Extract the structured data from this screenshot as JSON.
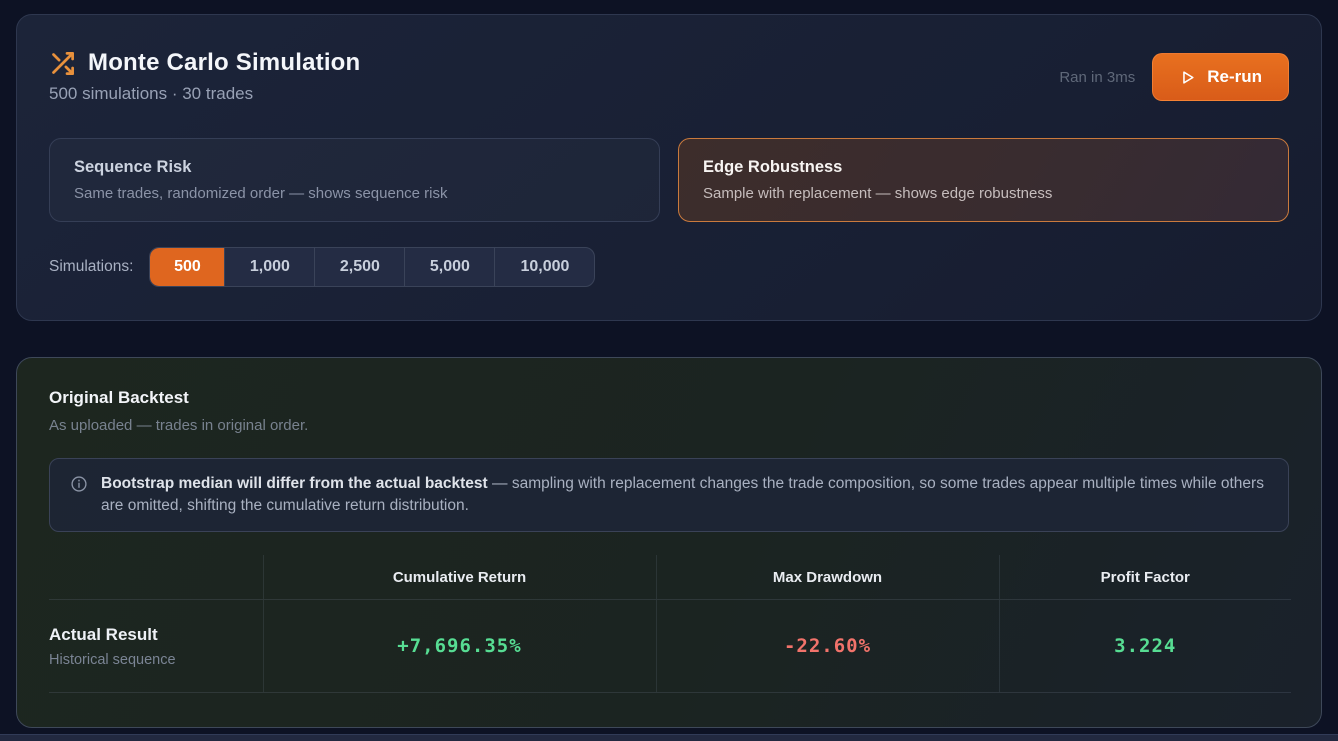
{
  "simulation_panel": {
    "title": "Monte Carlo Simulation",
    "subtitle": "500 simulations · 30 trades",
    "ran_in": "Ran in 3ms",
    "rerun_label": "Re-run",
    "modes": [
      {
        "title": "Sequence Risk",
        "description": "Same trades, randomized order — shows sequence risk",
        "selected": false
      },
      {
        "title": "Edge Robustness",
        "description": "Sample with replacement — shows edge robustness",
        "selected": true
      }
    ],
    "simulations_label": "Simulations:",
    "simulation_counts": [
      "500",
      "1,000",
      "2,500",
      "5,000",
      "10,000"
    ],
    "selected_count": "500"
  },
  "backtest_panel": {
    "title": "Original Backtest",
    "subtitle": "As uploaded — trades in original order.",
    "note": {
      "bold": "Bootstrap median will differ from the actual backtest",
      "rest": " — sampling with replacement changes the trade composition, so some trades appear multiple times while others are omitted, shifting the cumulative return distribution."
    },
    "table": {
      "columns": [
        "Cumulative Return",
        "Max Drawdown",
        "Profit Factor"
      ],
      "rows": [
        {
          "label": "Actual Result",
          "sublabel": "Historical sequence",
          "values": [
            "+7,696.35%",
            "-22.60%",
            "3.224"
          ],
          "value_colors": [
            "green",
            "red",
            "green"
          ]
        }
      ]
    }
  },
  "colors": {
    "accent_orange": "#df661f",
    "positive_green": "#57dd93",
    "negative_red": "#f2736b",
    "selected_mode_border": "#ca7a3d"
  }
}
